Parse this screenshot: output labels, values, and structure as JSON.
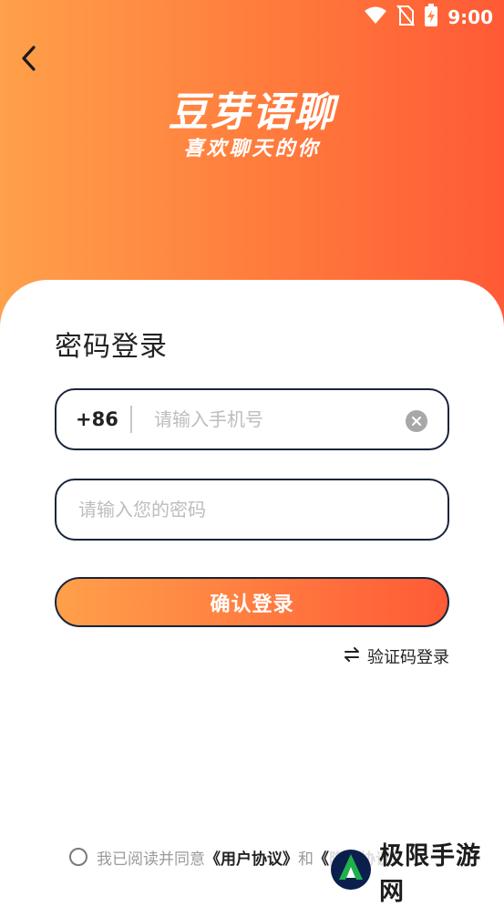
{
  "status_bar": {
    "time": "9:00",
    "icons": [
      "wifi-icon",
      "no-sim-icon",
      "battery-charging-icon"
    ]
  },
  "header": {
    "back_icon": "chevron-left-icon",
    "app_name": "豆芽语聊",
    "slogan": "喜欢聊天的你"
  },
  "form": {
    "title": "密码登录",
    "phone": {
      "country_code": "+86",
      "placeholder": "请输入手机号",
      "value": "",
      "clear_icon": "clear-icon"
    },
    "password": {
      "placeholder": "请输入您的密码",
      "value": ""
    },
    "submit_label": "确认登录",
    "switch_login_label": "验证码登录",
    "switch_icon": "swap-arrows-icon"
  },
  "agreement": {
    "prefix": "我已阅读并同意",
    "user_agreement": "《用户协议》",
    "conjunction": "和",
    "privacy_policy": "《隐私协议》",
    "checked": false
  },
  "watermark": {
    "text": "极限手游网"
  },
  "colors": {
    "gradient_start": "#ffa04a",
    "gradient_end": "#ff5a36",
    "border": "#19243b",
    "placeholder": "#bdbdbd"
  }
}
